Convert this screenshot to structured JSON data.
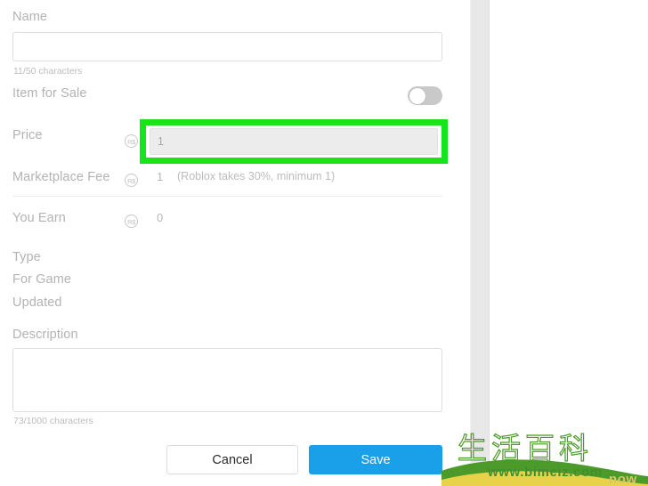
{
  "form": {
    "name": {
      "label": "Name",
      "value": "",
      "placeholder": "",
      "counter": "11/50 characters"
    },
    "item_for_sale": {
      "label": "Item for Sale",
      "state": "off"
    },
    "price": {
      "label": "Price",
      "currency_icon": "robux-icon",
      "currency_symbol": "R$",
      "value": "1",
      "placeholder": "1",
      "highlight_color": "#19e319"
    },
    "marketplace_fee": {
      "label": "Marketplace Fee",
      "currency_icon": "robux-icon",
      "currency_symbol": "R$",
      "value": "1",
      "note": "(Roblox takes 30%, minimum 1)"
    },
    "you_earn": {
      "label": "You Earn",
      "currency_icon": "robux-icon",
      "currency_symbol": "R$",
      "value": "0"
    },
    "meta": {
      "type_label": "Type",
      "for_game_label": "For Game",
      "updated_label": "Updated"
    },
    "description": {
      "label": "Description",
      "value": "",
      "placeholder": "",
      "counter": "73/1000 characters"
    },
    "actions": {
      "cancel_label": "Cancel",
      "save_label": "Save",
      "save_color": "#19a0e8"
    }
  },
  "watermark": {
    "cjk_text": "生活百科",
    "url_text": "www.bimeiz.com",
    "ghost_text": "now",
    "green": "#4c9a2a",
    "yellow": "#e8d24a"
  }
}
